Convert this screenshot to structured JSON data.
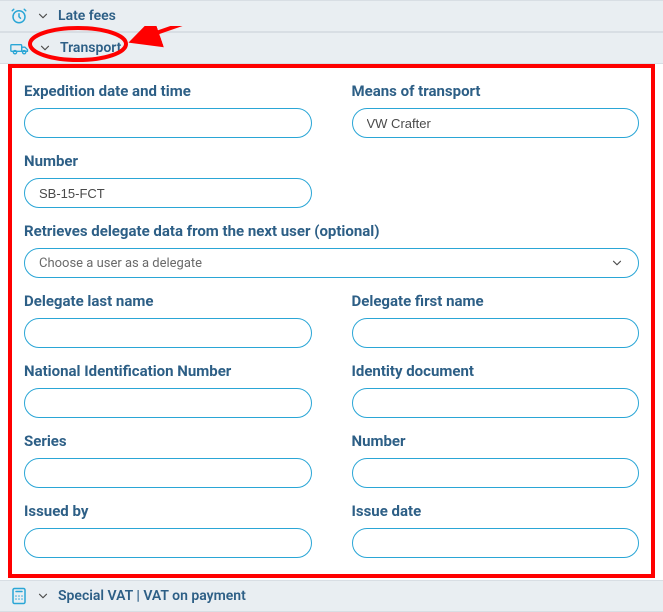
{
  "sections": {
    "late_fees": "Late fees",
    "transport": "Transport",
    "special_vat": "Special VAT | VAT on payment"
  },
  "form": {
    "expedition_label": "Expedition date and time",
    "expedition_value": "",
    "means_label": "Means of transport",
    "means_value": "VW Crafter",
    "number_top_label": "Number",
    "number_top_value": "SB-15-FCT",
    "retrieve_label": "Retrieves delegate data from the next user (optional)",
    "retrieve_placeholder": "Choose a user as a delegate",
    "del_last_label": "Delegate last name",
    "del_last_value": "",
    "del_first_label": "Delegate first name",
    "del_first_value": "",
    "nin_label": "National Identification Number",
    "nin_value": "",
    "identity_label": "Identity document",
    "identity_value": "",
    "series_label": "Series",
    "series_value": "",
    "number_bot_label": "Number",
    "number_bot_value": "",
    "issuedby_label": "Issued by",
    "issuedby_value": "",
    "issuedate_label": "Issue date",
    "issuedate_value": ""
  },
  "colors": {
    "accent": "#2aa6d6",
    "heading": "#2d5f86",
    "barbg": "#e9eef2",
    "annotation": "#ff0000"
  }
}
